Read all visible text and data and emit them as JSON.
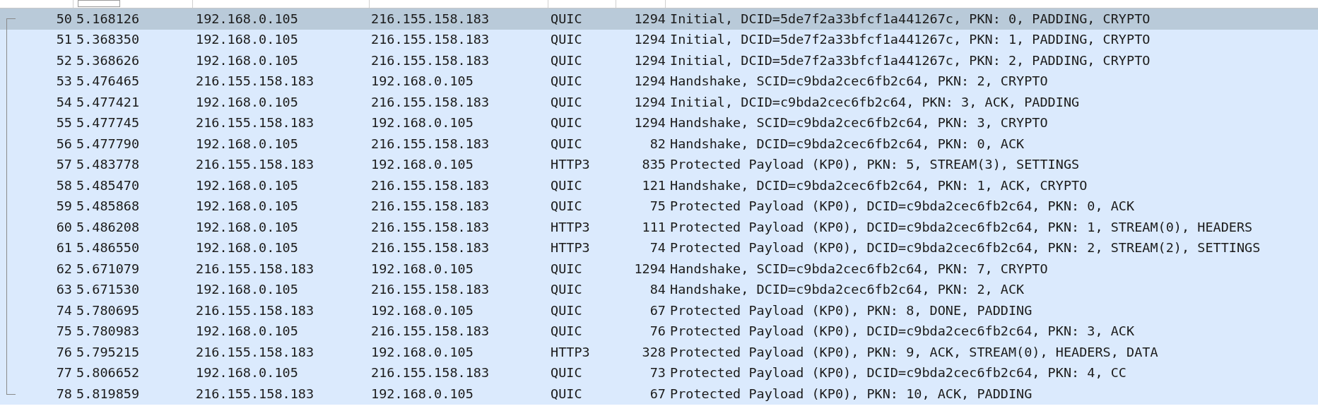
{
  "packet_list": {
    "rows": [
      {
        "no": "50",
        "time": "5.168126",
        "source": "192.168.0.105",
        "destination": "216.155.158.183",
        "protocol": "QUIC",
        "length": "1294",
        "info": "Initial, DCID=5de7f2a33bfcf1a441267c, PKN: 0, PADDING, CRYPTO",
        "selected": true
      },
      {
        "no": "51",
        "time": "5.368350",
        "source": "192.168.0.105",
        "destination": "216.155.158.183",
        "protocol": "QUIC",
        "length": "1294",
        "info": "Initial, DCID=5de7f2a33bfcf1a441267c, PKN: 1, PADDING, CRYPTO",
        "selected": false
      },
      {
        "no": "52",
        "time": "5.368626",
        "source": "192.168.0.105",
        "destination": "216.155.158.183",
        "protocol": "QUIC",
        "length": "1294",
        "info": "Initial, DCID=5de7f2a33bfcf1a441267c, PKN: 2, PADDING, CRYPTO",
        "selected": false
      },
      {
        "no": "53",
        "time": "5.476465",
        "source": "216.155.158.183",
        "destination": "192.168.0.105",
        "protocol": "QUIC",
        "length": "1294",
        "info": "Handshake, SCID=c9bda2cec6fb2c64, PKN: 2, CRYPTO",
        "selected": false
      },
      {
        "no": "54",
        "time": "5.477421",
        "source": "192.168.0.105",
        "destination": "216.155.158.183",
        "protocol": "QUIC",
        "length": "1294",
        "info": "Initial, DCID=c9bda2cec6fb2c64, PKN: 3, ACK, PADDING",
        "selected": false
      },
      {
        "no": "55",
        "time": "5.477745",
        "source": "216.155.158.183",
        "destination": "192.168.0.105",
        "protocol": "QUIC",
        "length": "1294",
        "info": "Handshake, SCID=c9bda2cec6fb2c64, PKN: 3, CRYPTO",
        "selected": false
      },
      {
        "no": "56",
        "time": "5.477790",
        "source": "192.168.0.105",
        "destination": "216.155.158.183",
        "protocol": "QUIC",
        "length": "82",
        "info": "Handshake, DCID=c9bda2cec6fb2c64, PKN: 0, ACK",
        "selected": false
      },
      {
        "no": "57",
        "time": "5.483778",
        "source": "216.155.158.183",
        "destination": "192.168.0.105",
        "protocol": "HTTP3",
        "length": "835",
        "info": "Protected Payload (KP0), PKN: 5, STREAM(3), SETTINGS",
        "selected": false
      },
      {
        "no": "58",
        "time": "5.485470",
        "source": "192.168.0.105",
        "destination": "216.155.158.183",
        "protocol": "QUIC",
        "length": "121",
        "info": "Handshake, DCID=c9bda2cec6fb2c64, PKN: 1, ACK, CRYPTO",
        "selected": false
      },
      {
        "no": "59",
        "time": "5.485868",
        "source": "192.168.0.105",
        "destination": "216.155.158.183",
        "protocol": "QUIC",
        "length": "75",
        "info": "Protected Payload (KP0), DCID=c9bda2cec6fb2c64, PKN: 0, ACK",
        "selected": false
      },
      {
        "no": "60",
        "time": "5.486208",
        "source": "192.168.0.105",
        "destination": "216.155.158.183",
        "protocol": "HTTP3",
        "length": "111",
        "info": "Protected Payload (KP0), DCID=c9bda2cec6fb2c64, PKN: 1, STREAM(0), HEADERS",
        "selected": false
      },
      {
        "no": "61",
        "time": "5.486550",
        "source": "192.168.0.105",
        "destination": "216.155.158.183",
        "protocol": "HTTP3",
        "length": "74",
        "info": "Protected Payload (KP0), DCID=c9bda2cec6fb2c64, PKN: 2, STREAM(2), SETTINGS",
        "selected": false
      },
      {
        "no": "62",
        "time": "5.671079",
        "source": "216.155.158.183",
        "destination": "192.168.0.105",
        "protocol": "QUIC",
        "length": "1294",
        "info": "Handshake, SCID=c9bda2cec6fb2c64, PKN: 7, CRYPTO",
        "selected": false
      },
      {
        "no": "63",
        "time": "5.671530",
        "source": "192.168.0.105",
        "destination": "216.155.158.183",
        "protocol": "QUIC",
        "length": "84",
        "info": "Handshake, DCID=c9bda2cec6fb2c64, PKN: 2, ACK",
        "selected": false
      },
      {
        "no": "74",
        "time": "5.780695",
        "source": "216.155.158.183",
        "destination": "192.168.0.105",
        "protocol": "QUIC",
        "length": "67",
        "info": "Protected Payload (KP0), PKN: 8, DONE, PADDING",
        "selected": false
      },
      {
        "no": "75",
        "time": "5.780983",
        "source": "192.168.0.105",
        "destination": "216.155.158.183",
        "protocol": "QUIC",
        "length": "76",
        "info": "Protected Payload (KP0), DCID=c9bda2cec6fb2c64, PKN: 3, ACK",
        "selected": false
      },
      {
        "no": "76",
        "time": "5.795215",
        "source": "216.155.158.183",
        "destination": "192.168.0.105",
        "protocol": "HTTP3",
        "length": "328",
        "info": "Protected Payload (KP0), PKN: 9, ACK, STREAM(0), HEADERS, DATA",
        "selected": false
      },
      {
        "no": "77",
        "time": "5.806652",
        "source": "192.168.0.105",
        "destination": "216.155.158.183",
        "protocol": "QUIC",
        "length": "73",
        "info": "Protected Payload (KP0), DCID=c9bda2cec6fb2c64, PKN: 4, CC",
        "selected": false
      },
      {
        "no": "78",
        "time": "5.819859",
        "source": "216.155.158.183",
        "destination": "192.168.0.105",
        "protocol": "QUIC",
        "length": "67",
        "info": "Protected Payload (KP0), PKN: 10, ACK, PADDING",
        "selected": false
      }
    ]
  }
}
